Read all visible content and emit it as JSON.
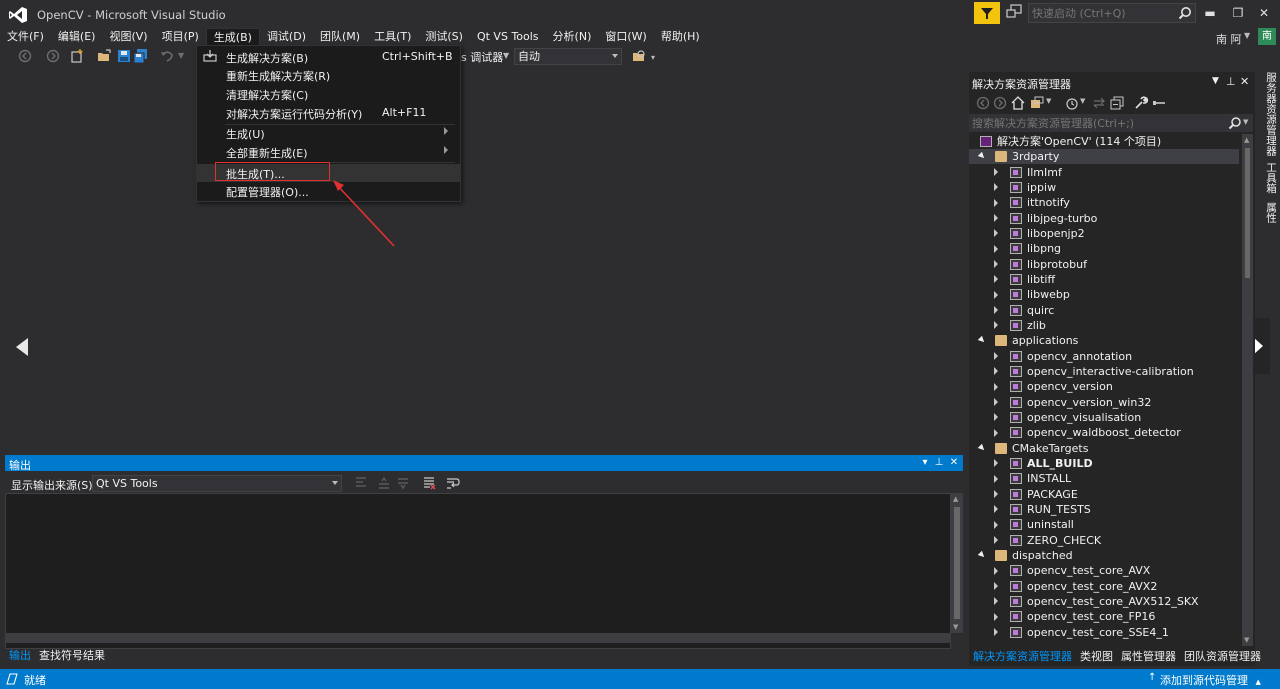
{
  "window": {
    "title": "OpenCV - Microsoft Visual Studio",
    "quick_launch_placeholder": "快速启动 (Ctrl+Q)",
    "user_name": "南 阿",
    "user_initial": "南",
    "minimize": "▬",
    "maximize": "❐",
    "close": "✕"
  },
  "menubar": {
    "items": [
      "文件(F)",
      "编辑(E)",
      "视图(V)",
      "项目(P)",
      "生成(B)",
      "调试(D)",
      "团队(M)",
      "工具(T)",
      "测试(S)",
      "Qt VS Tools",
      "分析(N)",
      "窗口(W)",
      "帮助(H)"
    ],
    "active_index": 4
  },
  "toolbar": {
    "debugger_label": "s 调试器",
    "config_value": "自动"
  },
  "build_menu": {
    "items": [
      {
        "label": "生成解决方案(B)",
        "shortcut": "Ctrl+Shift+B"
      },
      {
        "label": "重新生成解决方案(R)",
        "shortcut": ""
      },
      {
        "label": "清理解决方案(C)",
        "shortcut": ""
      },
      {
        "label": "对解决方案运行代码分析(Y)",
        "shortcut": "Alt+F11"
      },
      {
        "label": "生成(U)",
        "shortcut": ""
      },
      {
        "label": "全部重新生成(E)",
        "shortcut": ""
      },
      {
        "label": "批生成(T)...",
        "shortcut": ""
      },
      {
        "label": "配置管理器(O)...",
        "shortcut": ""
      }
    ],
    "highlighted_index": 6
  },
  "output_panel": {
    "title": "输出",
    "source_label": "显示输出来源(S):",
    "source_value": "Qt VS Tools",
    "tabs": [
      "输出",
      "查找符号结果"
    ],
    "active_tab": 0
  },
  "solution_explorer": {
    "title": "解决方案资源管理器",
    "search_placeholder": "搜索解决方案资源管理器(Ctrl+;)",
    "tree": [
      {
        "label": "解决方案'OpenCV' (114 个项目)",
        "level": 0,
        "kind": "solution",
        "expander": "none"
      },
      {
        "label": "3rdparty",
        "level": 0,
        "kind": "folder",
        "expander": "open",
        "selected": true
      },
      {
        "label": "IlmImf",
        "level": 1,
        "kind": "project",
        "expander": "closed"
      },
      {
        "label": "ippiw",
        "level": 1,
        "kind": "project",
        "expander": "closed"
      },
      {
        "label": "ittnotify",
        "level": 1,
        "kind": "project",
        "expander": "closed"
      },
      {
        "label": "libjpeg-turbo",
        "level": 1,
        "kind": "project",
        "expander": "closed"
      },
      {
        "label": "libopenjp2",
        "level": 1,
        "kind": "project",
        "expander": "closed"
      },
      {
        "label": "libpng",
        "level": 1,
        "kind": "project",
        "expander": "closed"
      },
      {
        "label": "libprotobuf",
        "level": 1,
        "kind": "project",
        "expander": "closed"
      },
      {
        "label": "libtiff",
        "level": 1,
        "kind": "project",
        "expander": "closed"
      },
      {
        "label": "libwebp",
        "level": 1,
        "kind": "project",
        "expander": "closed"
      },
      {
        "label": "quirc",
        "level": 1,
        "kind": "project",
        "expander": "closed"
      },
      {
        "label": "zlib",
        "level": 1,
        "kind": "project",
        "expander": "closed"
      },
      {
        "label": "applications",
        "level": 0,
        "kind": "folder",
        "expander": "open"
      },
      {
        "label": "opencv_annotation",
        "level": 1,
        "kind": "project",
        "expander": "closed"
      },
      {
        "label": "opencv_interactive-calibration",
        "level": 1,
        "kind": "project",
        "expander": "closed"
      },
      {
        "label": "opencv_version",
        "level": 1,
        "kind": "project",
        "expander": "closed"
      },
      {
        "label": "opencv_version_win32",
        "level": 1,
        "kind": "project",
        "expander": "closed"
      },
      {
        "label": "opencv_visualisation",
        "level": 1,
        "kind": "project",
        "expander": "closed"
      },
      {
        "label": "opencv_waldboost_detector",
        "level": 1,
        "kind": "project",
        "expander": "closed"
      },
      {
        "label": "CMakeTargets",
        "level": 0,
        "kind": "folder",
        "expander": "open"
      },
      {
        "label": "ALL_BUILD",
        "level": 1,
        "kind": "project",
        "expander": "closed",
        "bold": true
      },
      {
        "label": "INSTALL",
        "level": 1,
        "kind": "project",
        "expander": "closed"
      },
      {
        "label": "PACKAGE",
        "level": 1,
        "kind": "project",
        "expander": "closed"
      },
      {
        "label": "RUN_TESTS",
        "level": 1,
        "kind": "project",
        "expander": "closed"
      },
      {
        "label": "uninstall",
        "level": 1,
        "kind": "project",
        "expander": "closed"
      },
      {
        "label": "ZERO_CHECK",
        "level": 1,
        "kind": "project",
        "expander": "closed"
      },
      {
        "label": "dispatched",
        "level": 0,
        "kind": "folder",
        "expander": "open"
      },
      {
        "label": "opencv_test_core_AVX",
        "level": 1,
        "kind": "project",
        "expander": "closed"
      },
      {
        "label": "opencv_test_core_AVX2",
        "level": 1,
        "kind": "project",
        "expander": "closed"
      },
      {
        "label": "opencv_test_core_AVX512_SKX",
        "level": 1,
        "kind": "project",
        "expander": "closed"
      },
      {
        "label": "opencv_test_core_FP16",
        "level": 1,
        "kind": "project",
        "expander": "closed"
      },
      {
        "label": "opencv_test_core_SSE4_1",
        "level": 1,
        "kind": "project",
        "expander": "closed"
      }
    ],
    "tabs": [
      "解决方案资源管理器",
      "类视图",
      "属性管理器",
      "团队资源管理器"
    ],
    "active_tab": 0
  },
  "side_tabs": [
    "服务器资源管理器",
    "工具箱",
    "属性"
  ],
  "statusbar": {
    "status": "就绪",
    "source_control": "添加到源代码管理"
  },
  "colors": {
    "accent": "#007acc",
    "background": "#2d2d30",
    "annotation": "#e03030",
    "notification": "#f2c40d"
  }
}
